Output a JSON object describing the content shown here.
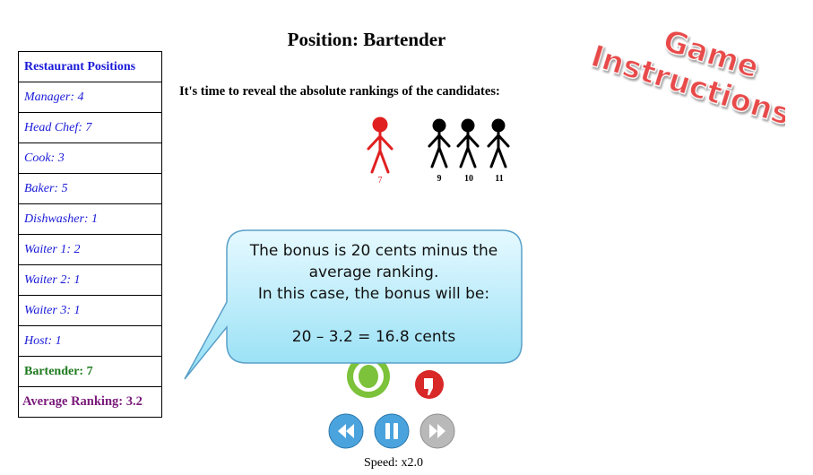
{
  "title": "Position: Bartender",
  "instructions": "It's time to reveal the absolute rankings of the candidates:",
  "game_instructions": {
    "line1": "Game",
    "line2": "Instructions"
  },
  "sidebar": {
    "header": "Restaurant Positions",
    "items": [
      {
        "label": "Manager: 4"
      },
      {
        "label": "Head Chef: 7"
      },
      {
        "label": "Cook: 3"
      },
      {
        "label": "Baker: 5"
      },
      {
        "label": "Dishwasher: 1"
      },
      {
        "label": "Waiter 1: 2"
      },
      {
        "label": "Waiter 2: 1"
      },
      {
        "label": "Waiter 3: 1"
      },
      {
        "label": "Host: 1"
      }
    ],
    "current": "Bartender: 7",
    "average": "Average Ranking: 3.2"
  },
  "candidates": [
    {
      "rank": "7",
      "color": "#e02020",
      "selected": true
    },
    {
      "rank": "9",
      "color": "#000000",
      "selected": false
    },
    {
      "rank": "10",
      "color": "#000000",
      "selected": false
    },
    {
      "rank": "11",
      "color": "#000000",
      "selected": false
    }
  ],
  "bubble": {
    "line1": "The bonus is 20 cents minus the",
    "line2": "average ranking.",
    "line3": "In this case, the bonus will be:",
    "line4": "20 – 3.2 = 16.8 cents"
  },
  "controls": {
    "thumbs_up_icon": "thumbs-up-icon",
    "thumbs_down_icon": "thumbs-down-icon",
    "rewind_icon": "rewind-icon",
    "pause_icon": "pause-icon",
    "forward_icon": "fast-forward-icon"
  },
  "speed": "Speed: x2.0",
  "colors": {
    "link_blue": "#1a1ad8",
    "current_green": "#1e7a1e",
    "average_purple": "#7a1a7a",
    "selected_red": "#e02020",
    "bubble_fill": "#b5ebfa",
    "button_blue": "#4aa3dc",
    "game_instr_red": "#e84a4a"
  }
}
